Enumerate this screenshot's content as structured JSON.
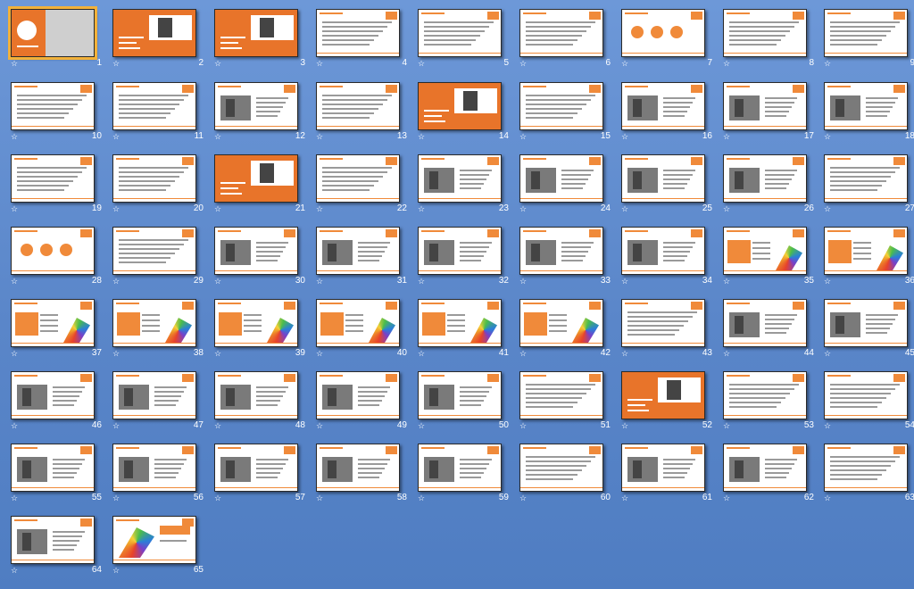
{
  "star_glyph": "☆",
  "accent_color": "#f08a3a",
  "selected_slide": "1",
  "slides": [
    {
      "num": "1",
      "style": "cover"
    },
    {
      "num": "2",
      "style": "orange"
    },
    {
      "num": "3",
      "style": "orange"
    },
    {
      "num": "4",
      "style": "content"
    },
    {
      "num": "5",
      "style": "content"
    },
    {
      "num": "6",
      "style": "content"
    },
    {
      "num": "7",
      "style": "circles"
    },
    {
      "num": "8",
      "style": "content"
    },
    {
      "num": "9",
      "style": "content"
    },
    {
      "num": "10",
      "style": "content"
    },
    {
      "num": "11",
      "style": "content"
    },
    {
      "num": "12",
      "style": "photo"
    },
    {
      "num": "13",
      "style": "content"
    },
    {
      "num": "14",
      "style": "orange"
    },
    {
      "num": "15",
      "style": "content"
    },
    {
      "num": "16",
      "style": "photo"
    },
    {
      "num": "17",
      "style": "photo"
    },
    {
      "num": "18",
      "style": "photo"
    },
    {
      "num": "19",
      "style": "content"
    },
    {
      "num": "20",
      "style": "content"
    },
    {
      "num": "21",
      "style": "orange"
    },
    {
      "num": "22",
      "style": "content"
    },
    {
      "num": "23",
      "style": "photo"
    },
    {
      "num": "24",
      "style": "photo"
    },
    {
      "num": "25",
      "style": "photo"
    },
    {
      "num": "26",
      "style": "photo"
    },
    {
      "num": "27",
      "style": "content"
    },
    {
      "num": "28",
      "style": "circles"
    },
    {
      "num": "29",
      "style": "content"
    },
    {
      "num": "30",
      "style": "photo"
    },
    {
      "num": "31",
      "style": "photo"
    },
    {
      "num": "32",
      "style": "photo"
    },
    {
      "num": "33",
      "style": "photo"
    },
    {
      "num": "34",
      "style": "photo"
    },
    {
      "num": "35",
      "style": "rainbow"
    },
    {
      "num": "36",
      "style": "rainbow"
    },
    {
      "num": "37",
      "style": "rainbow"
    },
    {
      "num": "38",
      "style": "rainbow"
    },
    {
      "num": "39",
      "style": "rainbow"
    },
    {
      "num": "40",
      "style": "rainbow"
    },
    {
      "num": "41",
      "style": "rainbow"
    },
    {
      "num": "42",
      "style": "rainbow"
    },
    {
      "num": "43",
      "style": "content"
    },
    {
      "num": "44",
      "style": "photo"
    },
    {
      "num": "45",
      "style": "photo"
    },
    {
      "num": "46",
      "style": "photo"
    },
    {
      "num": "47",
      "style": "photo"
    },
    {
      "num": "48",
      "style": "photo"
    },
    {
      "num": "49",
      "style": "photo"
    },
    {
      "num": "50",
      "style": "photo"
    },
    {
      "num": "51",
      "style": "content"
    },
    {
      "num": "52",
      "style": "orange"
    },
    {
      "num": "53",
      "style": "content"
    },
    {
      "num": "54",
      "style": "content"
    },
    {
      "num": "55",
      "style": "photo"
    },
    {
      "num": "56",
      "style": "photo"
    },
    {
      "num": "57",
      "style": "photo"
    },
    {
      "num": "58",
      "style": "photo"
    },
    {
      "num": "59",
      "style": "photo"
    },
    {
      "num": "60",
      "style": "content"
    },
    {
      "num": "61",
      "style": "photo"
    },
    {
      "num": "62",
      "style": "photo"
    },
    {
      "num": "63",
      "style": "content"
    },
    {
      "num": "64",
      "style": "photo"
    },
    {
      "num": "65",
      "style": "thanks"
    }
  ]
}
